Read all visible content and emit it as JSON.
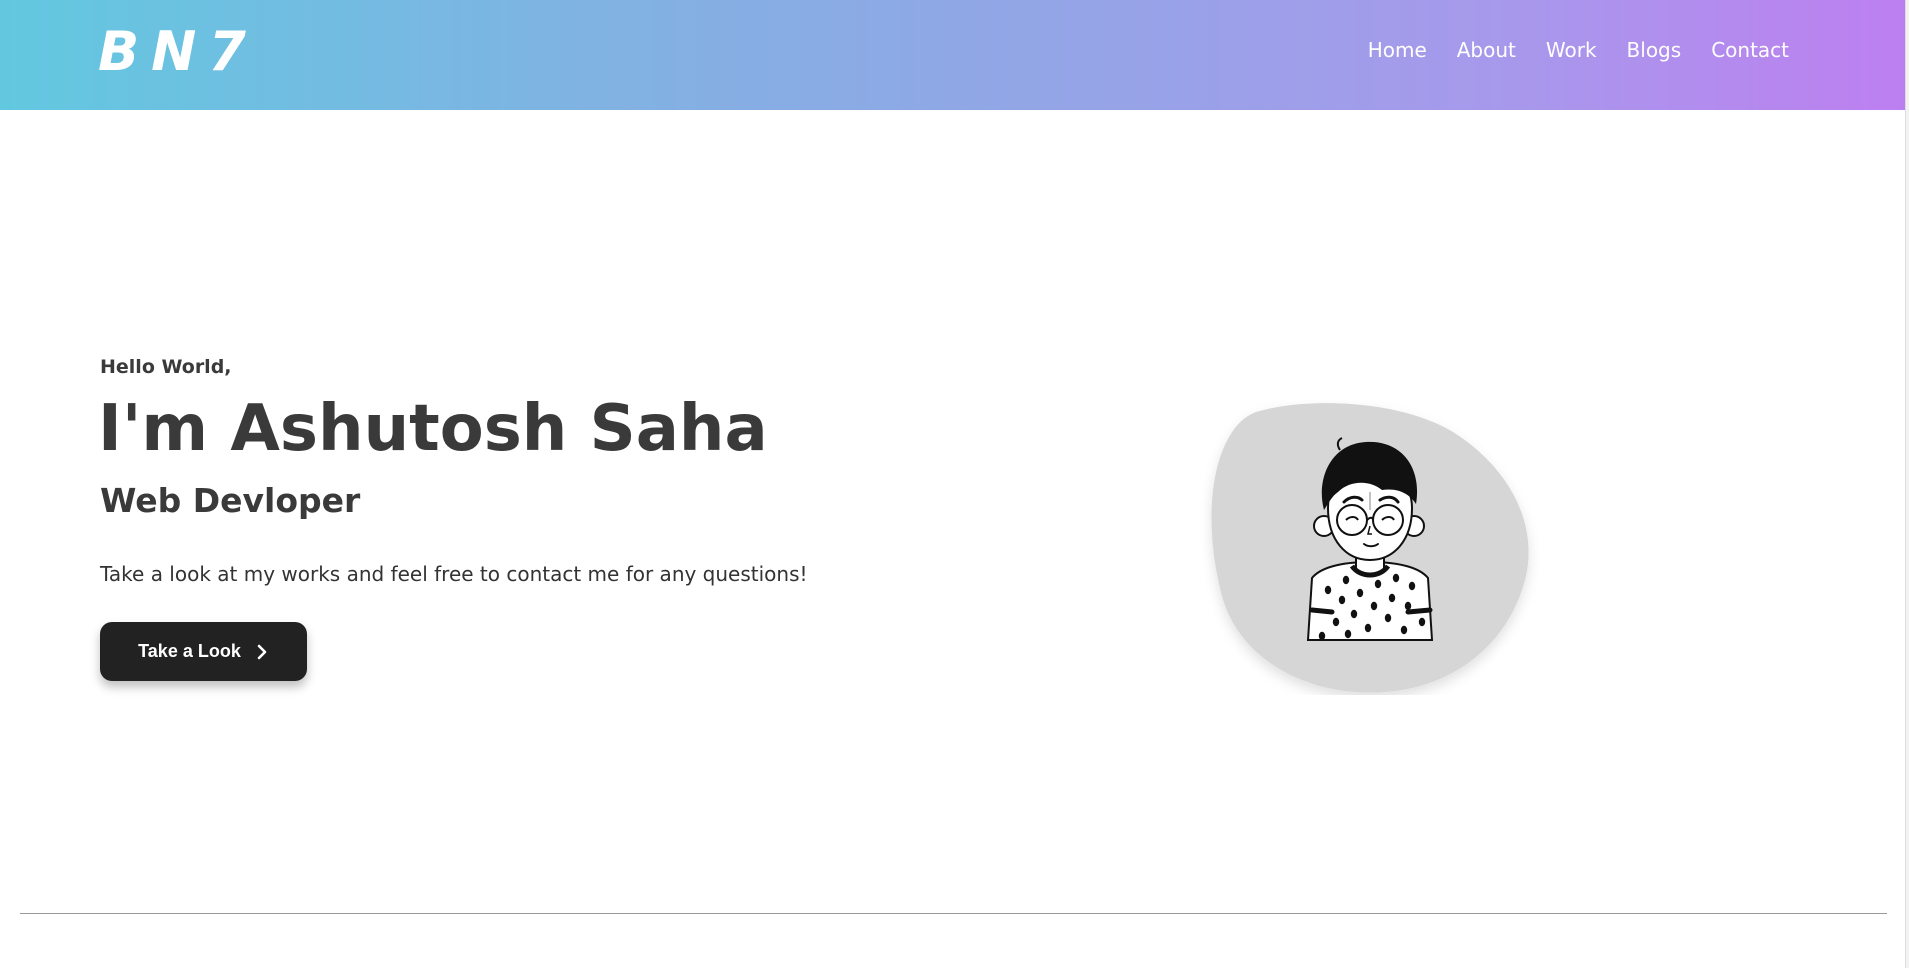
{
  "brand": {
    "logo": "BN7"
  },
  "nav": {
    "items": [
      {
        "label": "Home"
      },
      {
        "label": "About"
      },
      {
        "label": "Work"
      },
      {
        "label": "Blogs"
      },
      {
        "label": "Contact"
      }
    ]
  },
  "hero": {
    "greeting": "Hello World,",
    "name": "I'm Ashutosh Saha",
    "role": "Web Devloper",
    "tagline": "Take a look at my works and feel free to contact me for any questions!",
    "cta_label": "Take a Look",
    "cta_icon": "chevron-right-icon",
    "avatar_icon": "person-avatar-icon"
  },
  "colors": {
    "header_gradient_start": "#62c8e0",
    "header_gradient_end": "#bd7ff0",
    "text_dark": "#3a3a3a",
    "button_bg": "#222222",
    "blob_bg": "#d6d6d6"
  }
}
